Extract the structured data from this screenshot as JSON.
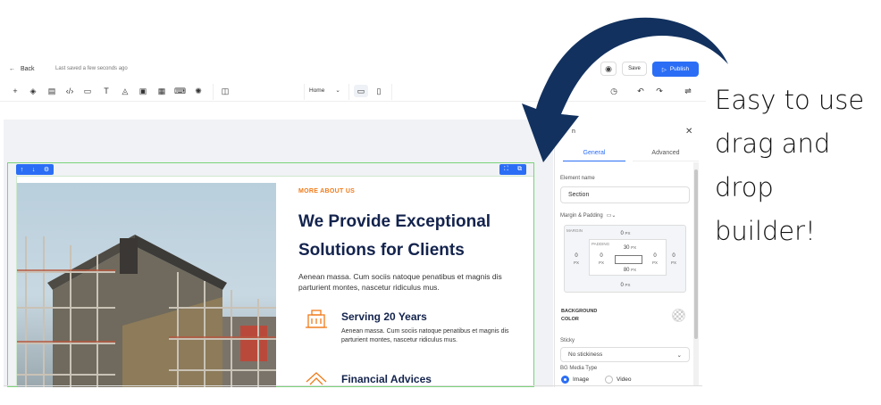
{
  "topbar": {
    "back_label": "Back",
    "saved_status": "Last saved a few seconds ago",
    "save_label": "Save",
    "publish_label": "Publish"
  },
  "toolbar": {
    "page_selected": "Home",
    "icons": [
      "plus-icon",
      "layers-icon",
      "page-icon",
      "code-icon",
      "comment-icon",
      "text-icon",
      "shapes-icon",
      "layout-icon",
      "form-icon",
      "terminal-icon",
      "settings-icon",
      "sidebar-toggle-icon",
      "desktop-icon",
      "mobile-icon",
      "history-icon",
      "undo-icon",
      "redo-icon",
      "sliders-icon"
    ]
  },
  "section": {
    "kicker": "MORE ABOUT US",
    "headline": "We Provide Exceptional Solutions for Clients",
    "intro": "Aenean massa. Cum sociis natoque penatibus et magnis dis parturient montes, nascetur ridiculus mus.",
    "features": [
      {
        "title": "Serving 20 Years",
        "text": "Aenean massa. Cum sociis natoque penatibus et magnis dis parturient montes, nascetur ridiculus mus."
      },
      {
        "title": "Financial Advices"
      }
    ]
  },
  "panel": {
    "title": "n",
    "tabs": [
      "General",
      "Advanced"
    ],
    "element_name_label": "Element name",
    "element_name_value": "Section",
    "margin_padding_label": "Margin & Padding",
    "margin_label": "MARGIN",
    "padding_label": "PADDING",
    "margin": {
      "top": "0",
      "right": "0",
      "bottom": "0",
      "left": "0",
      "unit": "PX"
    },
    "padding": {
      "top": "30",
      "right": "0",
      "bottom": "80",
      "left": "0",
      "unit": "PX"
    },
    "bg_color_label_1": "BACKGROUND",
    "bg_color_label_2": "COLOR",
    "sticky_label": "Sticky",
    "sticky_value": "No stickiness",
    "bg_media_label": "BG Media Type",
    "media_options": [
      "Image",
      "Video"
    ],
    "media_selected": "Image"
  },
  "callout": {
    "line1": "Easy to use",
    "line2": "drag and",
    "line3": "drop",
    "line4": "builder!"
  },
  "colors": {
    "accent": "#2b6ef5",
    "heading": "#13234d",
    "kicker": "#f07b1a",
    "arrow": "#12315f",
    "outline": "#7bd37b"
  }
}
